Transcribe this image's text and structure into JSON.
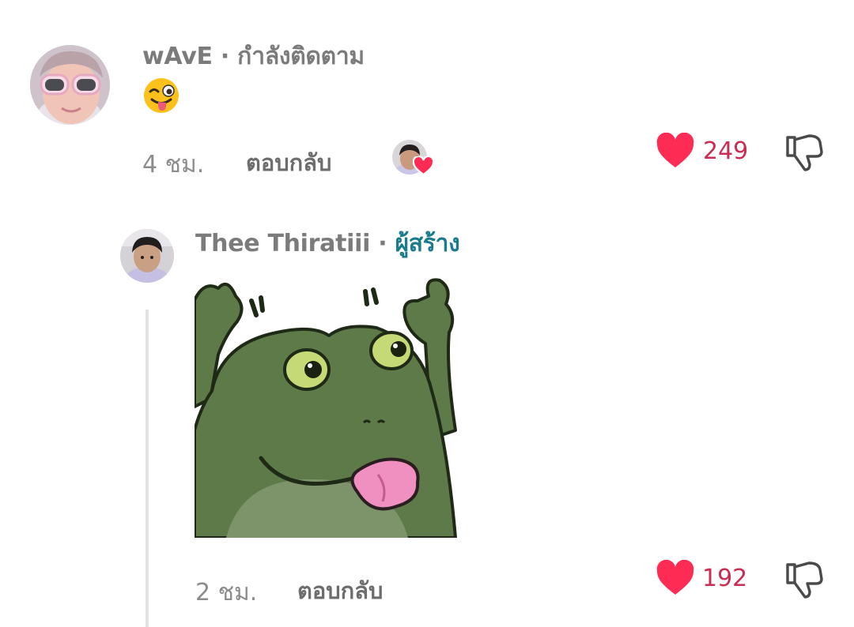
{
  "comments": [
    {
      "username": "wAvE",
      "separator": "·",
      "tag": "กำลังติดตาม",
      "body_emoji": "winking-face-with-tongue",
      "time": "4 ชม.",
      "reply_label": "ตอบกลับ",
      "liked_by_creator": true,
      "likes": "249"
    },
    {
      "username": "Thee Thiratiii",
      "separator": "·",
      "tag": "ผู้สร้าง",
      "body_sticker": "frog-sticker-tongue-out",
      "time": "2 ชม.",
      "reply_label": "ตอบกลับ",
      "likes": "192"
    }
  ],
  "colors": {
    "heart": "#fe2c55",
    "likes_text": "#ca2c54",
    "creator_tag": "#197b8c",
    "username": "#7b7b7b"
  }
}
